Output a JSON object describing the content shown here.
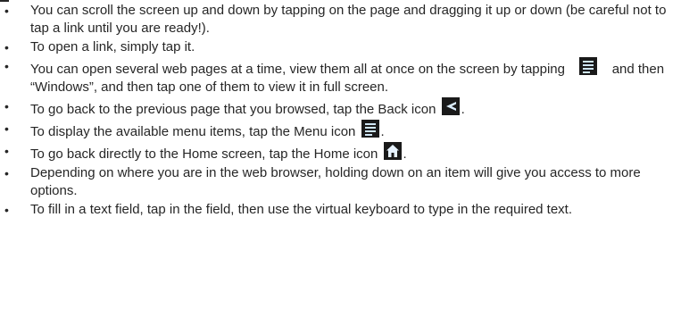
{
  "bullets": {
    "scroll": "You can scroll the screen up and down by tapping on the page and dragging it up or down (be careful not to tap a link until you are ready!).",
    "open_link": "To open a link, simply tap it.",
    "windows_a": "You can open several web pages at a time, view them all at once on the screen by tapping",
    "windows_b": "and then “Windows”, and then tap one of them to view it in full screen.",
    "back_a": "To go back to the previous page that you browsed, tap the Back icon",
    "back_b": ".",
    "menu_a": "To display the available menu items, tap the Menu icon",
    "menu_b": ".",
    "home_a": "To go back directly to the Home screen, tap the Home icon",
    "home_b": ".",
    "hold": "Depending on where you are in the web browser, holding down on an item will give you access to more options.",
    "fill": "To fill in a text field, tap in the field, then use the virtual keyboard to type in the required text."
  },
  "icons": {
    "menu": "menu-icon",
    "back": "back-icon",
    "home": "home-icon"
  },
  "colors": {
    "text": "#262626",
    "icon_bg": "#1a1a1a",
    "menu_lines": "#cfe6f5",
    "back_arrow": "#dbeefe",
    "home_glyph": "#e7f3ff"
  }
}
